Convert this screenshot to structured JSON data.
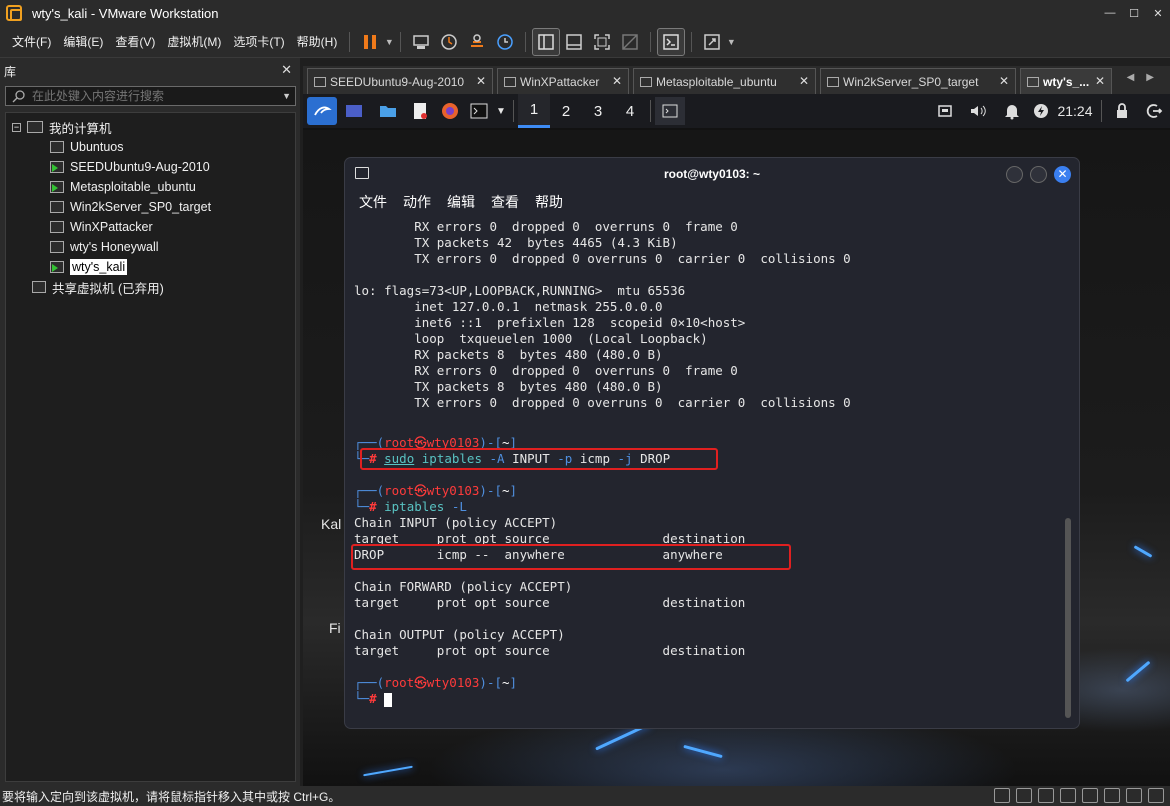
{
  "window": {
    "title": "wty's_kali - VMware Workstation"
  },
  "menu": [
    "文件(F)",
    "编辑(E)",
    "查看(V)",
    "虚拟机(M)",
    "选项卡(T)",
    "帮助(H)"
  ],
  "library": {
    "title": "库",
    "search_placeholder": "在此处键入内容进行搜索",
    "root": "我的计算机",
    "vms": [
      "Ubuntuos",
      "SEEDUbuntu9-Aug-2010",
      "Metasploitable_ubuntu",
      "Win2kServer_SP0_target",
      "WinXPattacker",
      "wty's Honeywall",
      "wty's_kali"
    ],
    "shared": "共享虚拟机 (已弃用)"
  },
  "tabs": [
    "SEEDUbuntu9-Aug-2010",
    "WinXPattacker",
    "Metasploitable_ubuntu",
    "Win2kServer_SP0_target",
    "wty's_..."
  ],
  "kali_panel": {
    "workspaces": [
      "1",
      "2",
      "3",
      "4"
    ],
    "clock": "21:24"
  },
  "desktop": {
    "label_kali": "Kal",
    "label_fi": "Fi"
  },
  "terminal": {
    "title": "root@wty0103: ~",
    "menu": [
      "文件",
      "动作",
      "编辑",
      "查看",
      "帮助"
    ],
    "lines_top": [
      "        RX errors 0  dropped 0  overruns 0  frame 0",
      "        TX packets 42  bytes 4465 (4.3 KiB)",
      "        TX errors 0  dropped 0 overruns 0  carrier 0  collisions 0",
      "",
      "lo: flags=73<UP,LOOPBACK,RUNNING>  mtu 65536",
      "        inet 127.0.0.1  netmask 255.0.0.0",
      "        inet6 ::1  prefixlen 128  scopeid 0×10<host>",
      "        loop  txqueuelen 1000  (Local Loopback)",
      "        RX packets 8  bytes 480 (480.0 B)",
      "        RX errors 0  dropped 0  overruns 0  frame 0",
      "        TX packets 8  bytes 480 (480.0 B)",
      "        TX errors 0  dropped 0 overruns 0  carrier 0  collisions 0"
    ],
    "prompt_user": "root",
    "prompt_sym": "㉿",
    "prompt_host": "wty0103",
    "prompt_dir": "~",
    "cmd1": {
      "sudo": "sudo",
      "bin": "iptables",
      "opt1": "-A",
      "arg1": "INPUT",
      "opt2": "-p",
      "arg2": "icmp",
      "opt3": "-j",
      "arg3": "DROP"
    },
    "cmd2": {
      "bin": "iptables",
      "opt": "-L"
    },
    "output": [
      "Chain INPUT (policy ACCEPT)",
      "target     prot opt source               destination",
      "DROP       icmp --  anywhere             anywhere",
      "",
      "Chain FORWARD (policy ACCEPT)",
      "target     prot opt source               destination",
      "",
      "Chain OUTPUT (policy ACCEPT)",
      "target     prot opt source               destination"
    ]
  },
  "status": {
    "hint": "要将输入定向到该虚拟机，请将鼠标指针移入其中或按 Ctrl+G。"
  },
  "colors": {
    "prompt_red": "#ff3b3b",
    "prompt_blue": "#4f8fdf",
    "highlight_box": "#e02020",
    "workspace_active": "#3e8cf5"
  }
}
